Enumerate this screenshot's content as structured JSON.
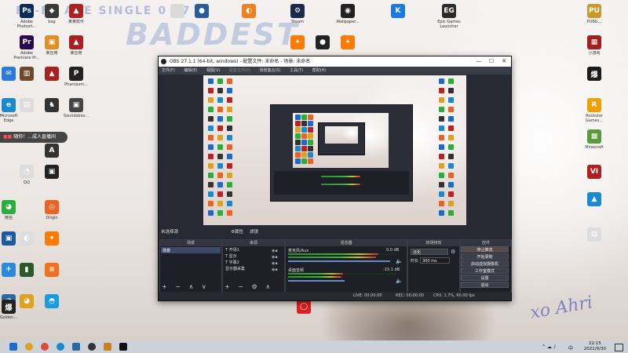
{
  "desktop": {
    "banner_top": "FR-FE ASE SINGLE 0 27",
    "banner_big": "BADDEST",
    "toast": {
      "text_red": "■■",
      "text": "随你！...成人直播间"
    },
    "signature": "xo Ahri",
    "icons": [
      {
        "id": "adobe-ps",
        "label": "Adobe Photosh...",
        "color": "#0a2a5a",
        "glyph": "Ps"
      },
      {
        "id": "app2",
        "label": "bag",
        "color": "#3a3a3a",
        "glyph": "◆"
      },
      {
        "id": "app3",
        "label": "某某软件",
        "color": "#b02020",
        "glyph": "▲"
      },
      {
        "id": "app4",
        "label": "",
        "color": "#dadada",
        "glyph": ""
      },
      {
        "id": "app5",
        "label": "",
        "color": "#2a5a9a",
        "glyph": "●"
      },
      {
        "id": "app6",
        "label": "",
        "color": "#f08020",
        "glyph": "◐"
      },
      {
        "id": "steam",
        "label": "Steam",
        "color": "#1a2a4a",
        "glyph": "⚙"
      },
      {
        "id": "wallpaper",
        "label": "Wallpaper...",
        "color": "#222",
        "glyph": "◉"
      },
      {
        "id": "kugou",
        "label": "",
        "color": "#1a7ae0",
        "glyph": "K"
      },
      {
        "id": "epic",
        "label": "Epic Games Launcher",
        "color": "#2a2a2a",
        "glyph": "EG"
      },
      {
        "id": "pubg",
        "label": "PUBG...",
        "color": "#c89a2a",
        "glyph": "PU"
      },
      {
        "id": "adobe-pr",
        "label": "Adobe Premiere Pr...",
        "color": "#2a0a4a",
        "glyph": "Pr"
      },
      {
        "id": "app13",
        "label": "某应用",
        "color": "#e09020",
        "glyph": "▣"
      },
      {
        "id": "app14",
        "label": "某应用",
        "color": "#aa2020",
        "glyph": "▲"
      },
      {
        "id": "app15",
        "label": "",
        "color": "#ff7a00",
        "glyph": "✦"
      },
      {
        "id": "app16",
        "label": "",
        "color": "#222",
        "glyph": "●"
      },
      {
        "id": "app17",
        "label": "",
        "color": "#ff7a00",
        "glyph": "✦"
      },
      {
        "id": "app18",
        "label": "小游戏",
        "color": "#a02020",
        "glyph": "▦"
      },
      {
        "id": "app19",
        "label": "",
        "color": "#2a7ae0",
        "glyph": "✉"
      },
      {
        "id": "app20",
        "label": "",
        "color": "#6a4a2a",
        "glyph": "▥"
      },
      {
        "id": "app21",
        "label": "",
        "color": "#aa2020",
        "glyph": "▲"
      },
      {
        "id": "app22",
        "label": "Phantasm...",
        "color": "#222",
        "glyph": "P"
      },
      {
        "id": "app23",
        "label": "",
        "color": "#1a1a1a",
        "glyph": "爆"
      },
      {
        "id": "edge",
        "label": "Microsoft Edge",
        "color": "#1a8ad0",
        "glyph": "e"
      },
      {
        "id": "app25",
        "label": "",
        "color": "#ddd",
        "glyph": "▤"
      },
      {
        "id": "app26",
        "label": "",
        "color": "#333",
        "glyph": "♞"
      },
      {
        "id": "app27",
        "label": "Soundsbox...",
        "color": "#444",
        "glyph": "▣"
      },
      {
        "id": "rockstar",
        "label": "Rockstar Games...",
        "color": "#f0a000",
        "glyph": "R"
      },
      {
        "id": "minecraft",
        "label": "Minecraft",
        "color": "#5a9a3a",
        "glyph": "▩"
      },
      {
        "id": "app31",
        "label": "",
        "color": "#333",
        "glyph": "A"
      },
      {
        "id": "qq",
        "label": "QQ",
        "color": "#ddd",
        "glyph": "◔"
      },
      {
        "id": "app33",
        "label": "",
        "color": "#222",
        "glyph": "▣"
      },
      {
        "id": "app34",
        "label": "",
        "color": "#b02020",
        "glyph": "VI"
      },
      {
        "id": "app35",
        "label": "",
        "color": "#1a8ad0",
        "glyph": "▲"
      },
      {
        "id": "wechat",
        "label": "微信",
        "color": "#2aae3a",
        "glyph": "◕"
      },
      {
        "id": "origin",
        "label": "Origin",
        "color": "#f06020",
        "glyph": "◎"
      },
      {
        "id": "app38",
        "label": "",
        "color": "#1a5aa0",
        "glyph": "▣"
      },
      {
        "id": "app39",
        "label": "",
        "color": "#ddd",
        "glyph": "◐"
      },
      {
        "id": "app40",
        "label": "",
        "color": "#ff7a00",
        "glyph": "✦"
      },
      {
        "id": "app41",
        "label": "",
        "color": "#2a8ae0",
        "glyph": "✈"
      },
      {
        "id": "app42",
        "label": "",
        "color": "#2a5a2a",
        "glyph": "▮"
      },
      {
        "id": "app43",
        "label": "",
        "color": "#f07020",
        "glyph": "≡"
      },
      {
        "id": "app44",
        "label": "",
        "color": "#2a6aa0",
        "glyph": "◑"
      },
      {
        "id": "app45",
        "label": "",
        "color": "#e0a020",
        "glyph": "◕"
      },
      {
        "id": "app46",
        "label": "",
        "color": "#1a9ae0",
        "glyph": "◓"
      },
      {
        "id": "app47",
        "label": "",
        "color": "#e02020",
        "glyph": "◯"
      },
      {
        "id": "app48",
        "label": "Golden...",
        "color": "#222",
        "glyph": "爆"
      },
      {
        "id": "app49",
        "label": "",
        "color": "#ddd",
        "glyph": "▤"
      }
    ]
  },
  "obs": {
    "title": "OBS 27.1.1 (64-bit, windows) - 配置文件: 未命名 - 场景: 未命名",
    "menu": [
      "文件(F)",
      "编辑(E)",
      "视图(V)",
      "配置文件(P)",
      "场景集合(S)",
      "工具(T)",
      "帮助(H)"
    ],
    "window_controls": [
      "—",
      "☐",
      "✕"
    ],
    "no_source": "未选择源",
    "props_btn": "⚙属性",
    "filters_btn": "滤镜",
    "docks": {
      "scenes": {
        "title": "场景",
        "items": [
          "场景"
        ]
      },
      "sources": {
        "title": "来源",
        "items": [
          "T 开场1",
          "T 显示",
          "T 字幕2",
          "显示器采集"
        ]
      },
      "mixer": {
        "title": "混音器",
        "tracks": [
          {
            "name": "麦克风/Aux",
            "db": "0.0 dB"
          },
          {
            "name": "桌面音频",
            "db": "-15.1 dB"
          }
        ]
      },
      "transitions": {
        "title": "转场特效",
        "type": "淡化",
        "duration_label": "时长",
        "duration": "300 ms"
      },
      "controls": {
        "title": "控件",
        "buttons": [
          "停止推流",
          "开始录制",
          "启动虚拟摄像机",
          "工作室模式",
          "设置",
          "退出"
        ]
      }
    },
    "status": {
      "live": "LIVE: 00:00:00",
      "rec": "REC: 00:00:00",
      "cpu": "CPU: 1.7%, 60.00 fps"
    }
  },
  "taskbar": {
    "time": "22:15",
    "date": "2021/9/30",
    "lang": "中",
    "tray": "^ ☁ ♪"
  }
}
